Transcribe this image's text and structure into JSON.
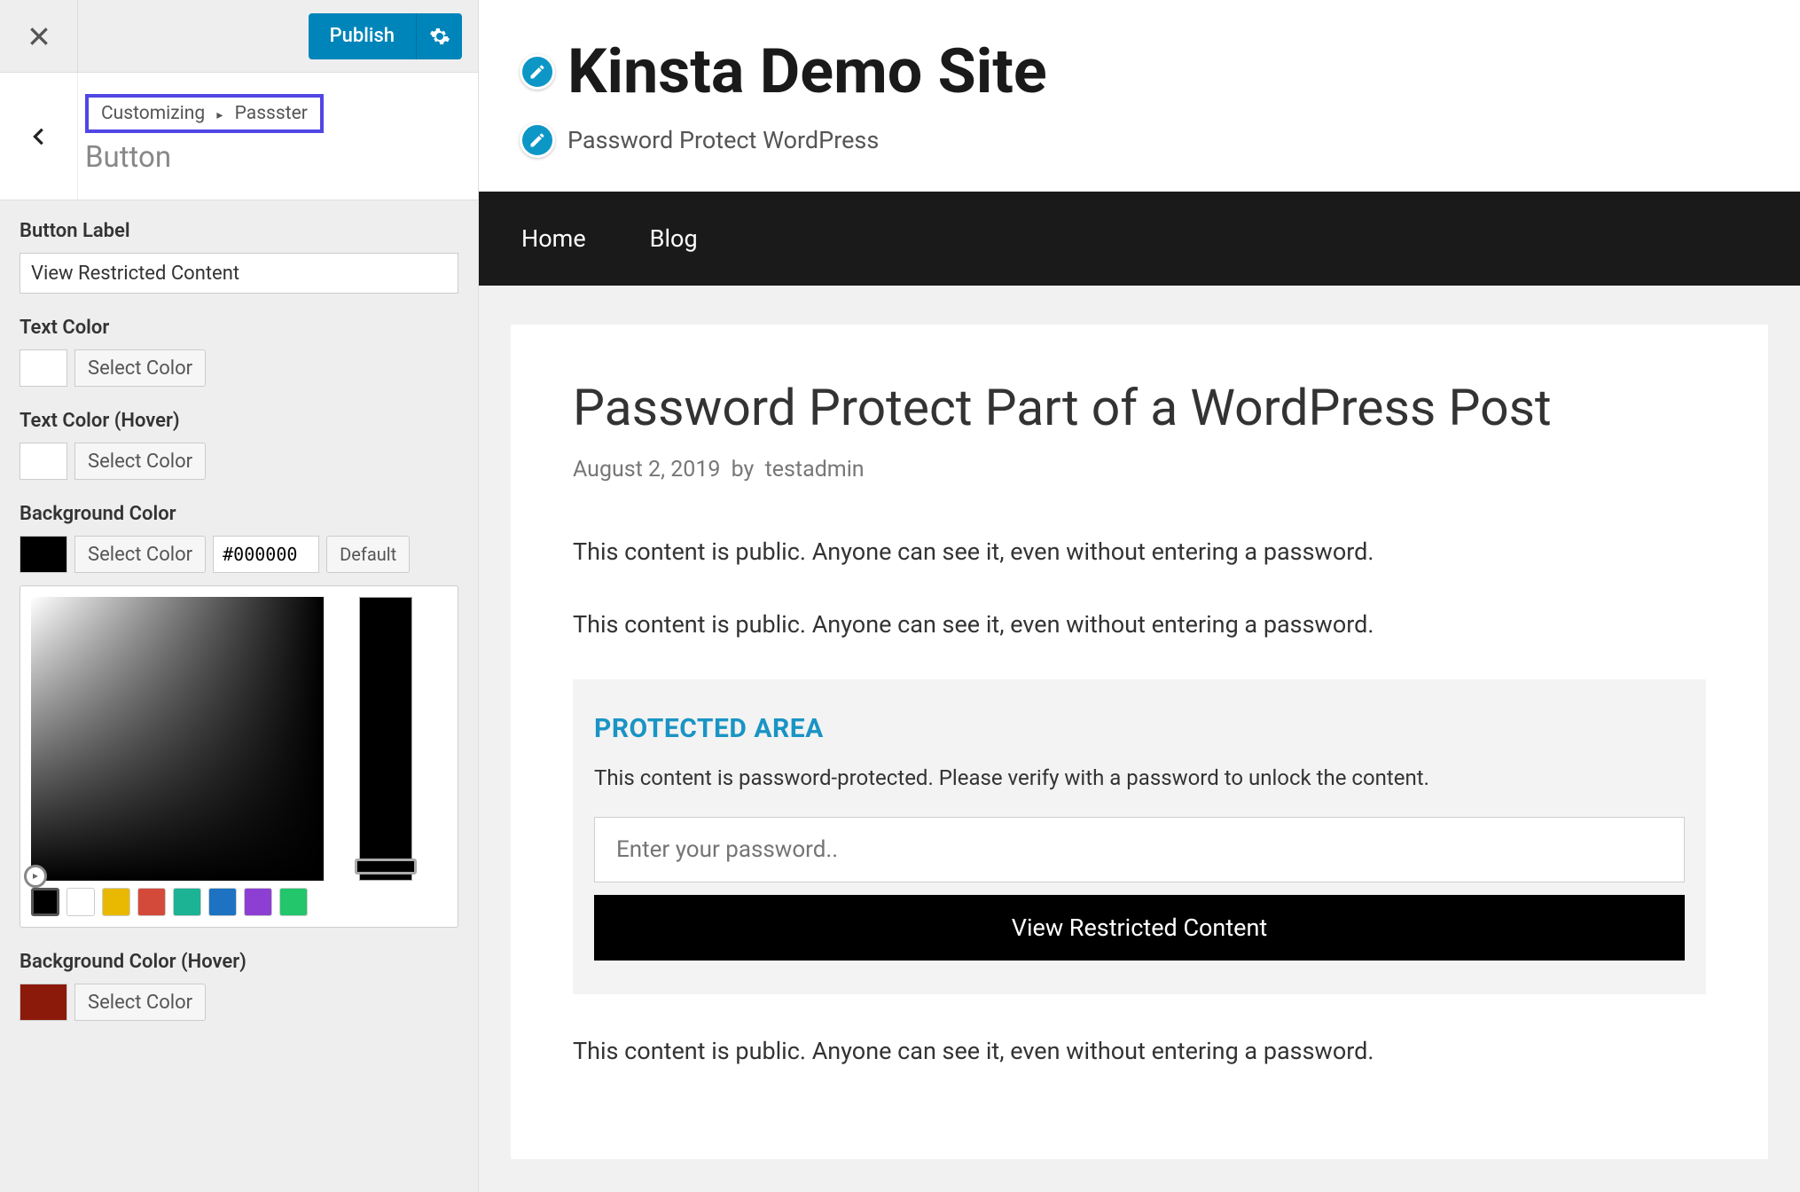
{
  "customizer": {
    "publish_label": "Publish",
    "breadcrumb": {
      "root": "Customizing",
      "section": "Passster"
    },
    "panel_title": "Button",
    "fields": {
      "button_label": {
        "label": "Button Label",
        "value": "View Restricted Content"
      },
      "text_color": {
        "label": "Text Color",
        "select": "Select Color"
      },
      "text_color_hover": {
        "label": "Text Color (Hover)",
        "select": "Select Color"
      },
      "background_color": {
        "label": "Background Color",
        "select": "Select Color",
        "hex": "#000000",
        "default": "Default"
      },
      "background_color_hover": {
        "label": "Background Color (Hover)",
        "select": "Select Color"
      }
    },
    "presets": [
      "#000000",
      "#ffffff",
      "#e8b900",
      "#d44a3a",
      "#1bb394",
      "#1d72c2",
      "#8e3fd3",
      "#23c66b"
    ]
  },
  "preview": {
    "site_title": "Kinsta Demo Site",
    "site_tagline": "Password Protect WordPress",
    "nav": [
      "Home",
      "Blog"
    ],
    "post": {
      "title": "Password Protect Part of a WordPress Post",
      "date": "August 2, 2019",
      "by_label": "by",
      "author": "testadmin",
      "public_line": "This content is public. Anyone can see it, even without entering a password.",
      "protected": {
        "heading": "PROTECTED AREA",
        "message": "This content is password-protected. Please verify with a password to unlock the content.",
        "placeholder": "Enter your password..",
        "button": "View Restricted Content"
      }
    }
  }
}
